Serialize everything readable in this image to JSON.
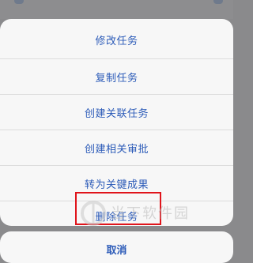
{
  "action_sheet": {
    "items": [
      {
        "label": "修改任务"
      },
      {
        "label": "复制任务"
      },
      {
        "label": "创建关联任务"
      },
      {
        "label": "创建相关审批"
      },
      {
        "label": "转为关键成果"
      },
      {
        "label": "删除任务"
      }
    ],
    "cancel_label": "取消"
  },
  "watermark": {
    "text": "当下软件园"
  },
  "colors": {
    "accent": "#2c5bb8",
    "highlight_border": "#e0141b",
    "sheet_background": "#f7f7f7",
    "overlay": "#8a8a8c"
  }
}
